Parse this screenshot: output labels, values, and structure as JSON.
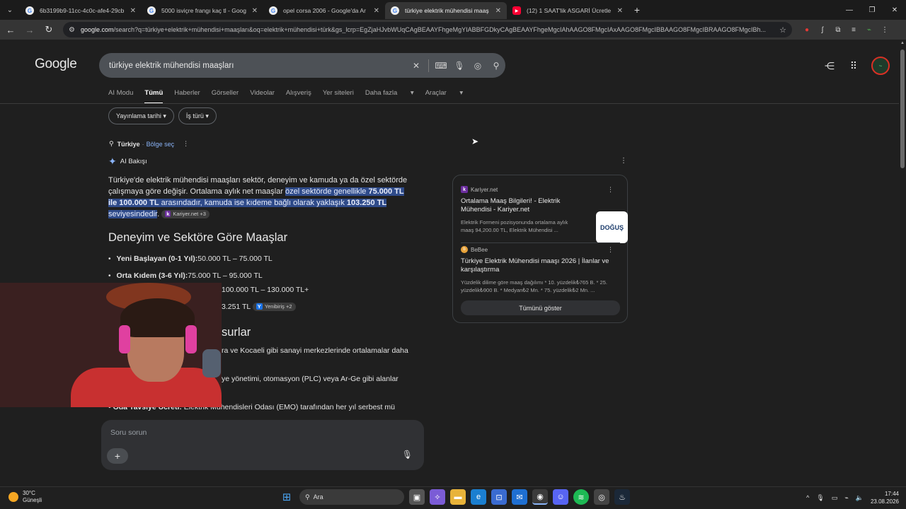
{
  "browser": {
    "tabs": [
      {
        "title": "6b3199b9-11cc-4c0c-afe4-29cb",
        "favicon": "G"
      },
      {
        "title": "5000 isviçre frangı kaç tl - Goog",
        "favicon": "G"
      },
      {
        "title": "opel corsa 2006 - Google'da Ar",
        "favicon": "G"
      },
      {
        "title": "türkiye elektrik mühendisi maaş",
        "favicon": "G"
      },
      {
        "title": "(12) 1 SAAT'lik ASGARİ Ücretle İ",
        "favicon": "▶"
      }
    ],
    "url_host": "google.com",
    "url_rest": "/search?q=türkiye+elektrik+mühendisi+maaşları&oq=elektrik+mühendisi+türk&gs_lcrp=EgZjaHJvbWUqCAgBEAAYFhgeMgYIABBFGDkyCAgBEAAYFhgeMgcIAhAAGO8FMgcIAxAAGO8FMgcIBBAAGO8FMgcIBRAAGO8FMgcIBh..."
  },
  "google": {
    "logo": "Google",
    "query": "türkiye elektrik mühendisi maaşları",
    "tabs": [
      "AI Modu",
      "Tümü",
      "Haberler",
      "Görseller",
      "Videolar",
      "Alışveriş",
      "Yer siteleri",
      "Daha fazla",
      "Araçlar"
    ],
    "chips": [
      "Yayınlama tarihi",
      "İş türü"
    ],
    "location": {
      "country": "Türkiye",
      "link": "Bölge seç"
    },
    "ai_overview_label": "AI Bakışı",
    "overview": {
      "plain": "Türkiye'de elektrik mühendisi maaşları sektör, deneyim ve kamuda ya da özel sektörde çalışmaya göre değişir. Ortalama aylık net maaşlar ",
      "hl_1": "özel sektörde genellikle ",
      "hl_2": "75.000 TL ile 100.000 TL",
      "hl_3": " arasındadır, kamuda ise kıdeme bağlı olarak yaklaşık ",
      "hl_4": "103.250 TL",
      "hl_5": " seviyesindedir",
      "source_pill": "Kariyer.net +3"
    },
    "section1_title": "Deneyim ve Sektöre Göre Maaşlar",
    "items": [
      {
        "label": "Yeni Başlayan (0-1 Yıl):",
        "value": " 50.000 TL – 75.000 TL"
      },
      {
        "label": "Orta Kıdem (3-6 Yıl):",
        "value": " 75.000 TL – 95.000 TL"
      }
    ],
    "partial_line3": "100.000 TL – 130.000 TL+",
    "partial_line4": "3.251 TL",
    "partial_pill": "Yenibiriş +2",
    "section2_partial": "surlar",
    "partial_line5": "ra ve Kocaeli gibi sanayi merkezlerinde ortalamalar daha",
    "partial_line6": "ye yönetimi, otomasyon (PLC) veya Ar-Ge gibi alanlar",
    "partial_line7_label": "Oda Tavsiye Ücreti:",
    "partial_line7": " Elektrik Mühendisleri Odası (EMO) tarafından her yıl serbest mü",
    "panel": {
      "item1": {
        "source": "Kariyer.net",
        "title": "Ortalama Maaş Bilgileri! - Elektrik Mühendisi - Kariyer.net",
        "snippet": "Elektrik Formeni pozisyonunda ortalama aylık maaş 94,200.00 TL, Elektrik Mühendisi ...",
        "thumb": "DOĞUŞ"
      },
      "item2": {
        "source": "BeBee",
        "title": "Türkiye Elektrik Mühendisi maaşı 2026 | İlanlar ve karşılaştırma",
        "snippet": "Yüzdelik dilime göre maaş dağılımı * 10. yüzdelik₺765 B. * 25. yüzdelik₺900 B. * Medyan₺2 Mn. * 75. yüzdelik₺2 Mn. ..."
      },
      "show_all": "Tümünü göster"
    },
    "ask_placeholder": "Soru sorun"
  },
  "taskbar": {
    "temp": "30°C",
    "weather": "Güneşli",
    "search": "Ara",
    "time": "17:44",
    "date": "23.08.2026"
  }
}
